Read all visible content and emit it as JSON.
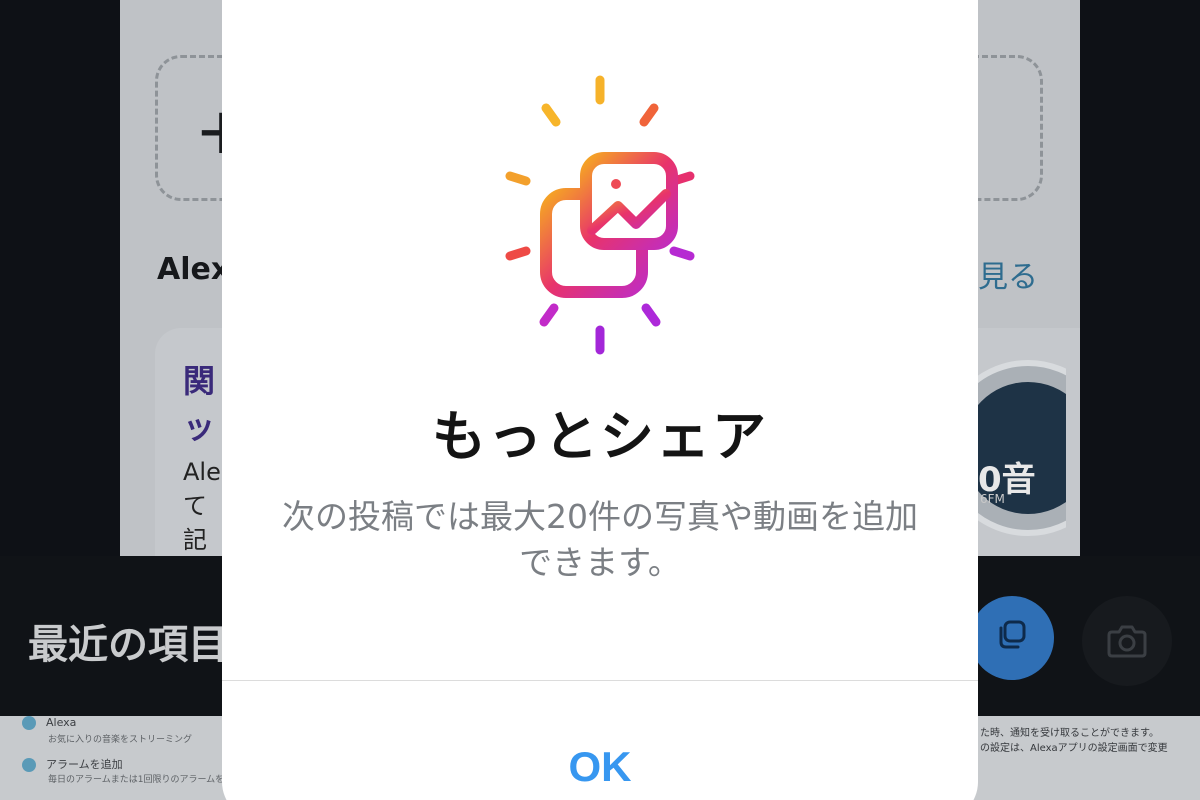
{
  "background": {
    "add_box_icon": "plus-icon",
    "alexa_heading": "Alex",
    "see_all_link": "見る",
    "promo": {
      "title": "関\nッ",
      "body": "Ale\nて記"
    },
    "disc_text": "0音",
    "disc_sub": "6FM",
    "recent_label": "最近の項目",
    "multi_select_icon": "multi-select-icon",
    "camera_icon": "camera-icon",
    "list": {
      "row1_title": "Alexa",
      "row1_sub": "お気に入りの音楽をストリーミング",
      "row2_title": "アラームを追加",
      "row2_sub": "毎日のアラームまたは1回限りのアラームを",
      "right_text": "た時、通知を受け取ることができます。\nの設定は、Alexaアプリの設定画面で変更"
    }
  },
  "modal": {
    "illustration_icon": "multiple-photos-icon",
    "title": "もっとシェア",
    "message": "次の投稿では最大20件の写真や動画を追加できます。",
    "ok_label": "OK"
  },
  "colors": {
    "accent_blue": "#3797f0",
    "gradient_start": "#f5a623",
    "gradient_mid": "#e8336b",
    "gradient_end": "#a727d8"
  }
}
